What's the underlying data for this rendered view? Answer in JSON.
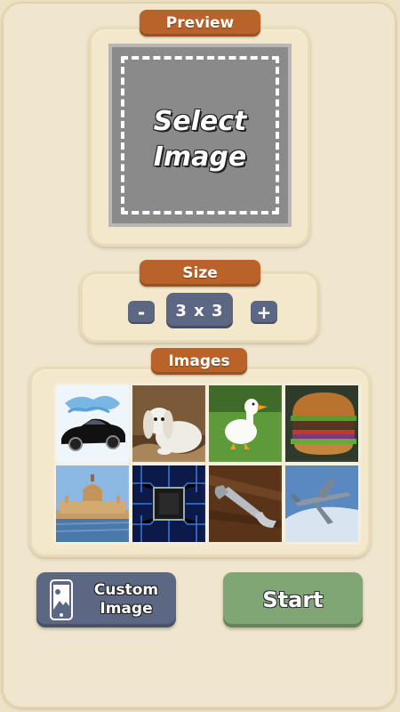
{
  "preview": {
    "title": "Preview",
    "placeholder_line1": "Select",
    "placeholder_line2": "Image"
  },
  "size": {
    "title": "Size",
    "minus_label": "-",
    "value": "3 x 3",
    "plus_label": "+"
  },
  "images": {
    "title": "Images",
    "items": [
      "car-image",
      "rabbit-image",
      "duck-image",
      "burger-image",
      "parliament-image",
      "chip-image",
      "wrench-image",
      "jet-image"
    ]
  },
  "buttons": {
    "custom_line1": "Custom",
    "custom_line2": "Image",
    "start": "Start"
  },
  "colors": {
    "background": "#eee2c6",
    "pill": "#b9632a",
    "button_blue": "#5c6883",
    "start_green": "#7fa674"
  },
  "icons": {
    "custom_image_icon": "phone-photo-icon"
  }
}
